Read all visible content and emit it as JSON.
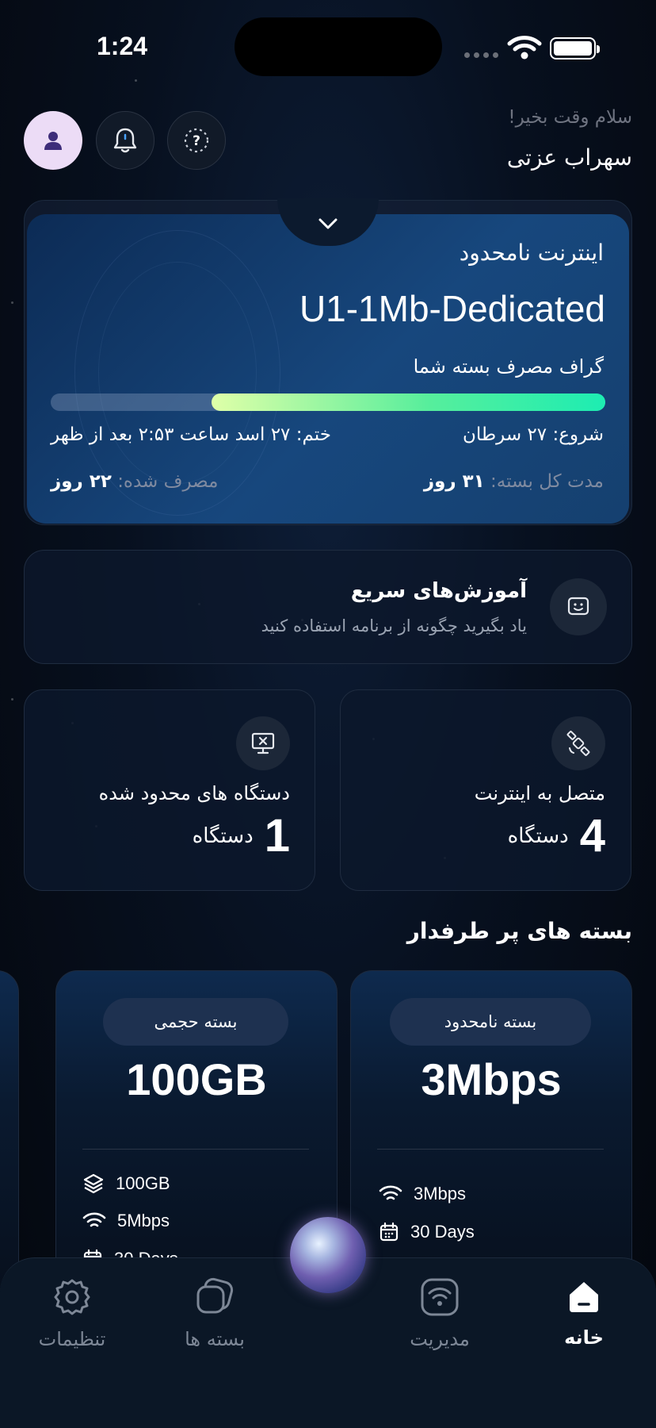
{
  "status_bar": {
    "time": "1:24"
  },
  "header": {
    "greeting": "سلام وقت بخیر!",
    "username": "سهراب عزتی",
    "icons": [
      "user-icon",
      "bell-icon",
      "help-icon"
    ]
  },
  "plan": {
    "type": "اینترنت نامحدود",
    "name": "U1-1Mb-Dedicated",
    "graph_label": "گراف مصرف بسته شما",
    "usage_fraction": 0.71,
    "start": "شروع: ۲۷ سرطان",
    "end": "ختم: ۲۷ اسد ساعت ۲:۵۳ بعد از ظهر",
    "total_label": "مدت کل بسته:",
    "total_value": "۳۱ روز",
    "used_label": "مصرف شده:",
    "used_value": "۲۲ روز"
  },
  "tutorial": {
    "title": "آموزش‌های سریع",
    "subtitle": "یاد بگیرید چگونه از برنامه استفاده کنید"
  },
  "devices": {
    "connected": {
      "title": "متصل به اینترنت",
      "count": "4",
      "unit": "دستگاه"
    },
    "restricted": {
      "title": "دستگاه های محدود شده",
      "count": "1",
      "unit": "دستگاه"
    }
  },
  "popular": {
    "title": "بسته های پر طرفدار",
    "packages": [
      {
        "badge": "بسته نامحدود",
        "value": "3Mbps",
        "features": [
          "3Mbps",
          "30 Days"
        ]
      },
      {
        "badge": "بسته حجمی",
        "value": "100GB",
        "features": [
          "100GB",
          "5Mbps",
          "30 Days"
        ]
      }
    ]
  },
  "nav": {
    "items": [
      {
        "label": "خانه",
        "icon": "home-icon",
        "active": true
      },
      {
        "label": "مدیریت",
        "icon": "wifi-manage-icon",
        "active": false
      },
      {
        "label": "بسته ها",
        "icon": "packages-icon",
        "active": false
      },
      {
        "label": "تنظیمات",
        "icon": "settings-icon",
        "active": false
      }
    ]
  },
  "colors": {
    "accent_green": "#1dedb2",
    "avatar_bg": "#ecdcf6"
  }
}
